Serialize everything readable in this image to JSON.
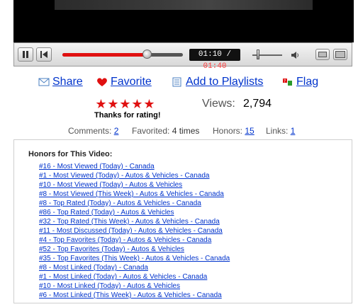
{
  "player": {
    "time_current": "01:10",
    "time_separator": " / ",
    "time_total": "01:40",
    "progress_fraction": 0.7,
    "volume_fraction": 0.2,
    "icons": [
      "pause-icon",
      "previous-icon",
      "volume-icon",
      "normal-size-icon",
      "fullscreen-icon"
    ]
  },
  "actions": {
    "share": "Share",
    "favorite": "Favorite",
    "add_to_playlists": "Add to Playlists",
    "flag": "Flag",
    "icons": [
      "envelope-icon",
      "heart-icon",
      "playlist-icon",
      "flag-icon"
    ]
  },
  "rating": {
    "stars": 5,
    "thanks": "Thanks for rating!"
  },
  "views": {
    "label": "Views:",
    "value": "2,794"
  },
  "stats": {
    "comments_label": "Comments:",
    "comments_value": "2",
    "favorited_label": "Favorited:",
    "favorited_value": "4 times",
    "honors_label": "Honors:",
    "honors_value": "15",
    "links_label": "Links:",
    "links_value": "1"
  },
  "honors": {
    "title": "Honors for This Video:",
    "items": [
      "#16 - Most Viewed (Today) - Canada",
      "#1 - Most Viewed (Today) - Autos & Vehicles - Canada",
      "#10 - Most Viewed (Today) - Autos & Vehicles",
      "#8 - Most Viewed (This Week) - Autos & Vehicles - Canada",
      "#8 - Top Rated (Today) - Autos & Vehicles - Canada",
      "#86 - Top Rated (Today) - Autos & Vehicles",
      "#32 - Top Rated (This Week) - Autos & Vehicles - Canada",
      "#11 - Most Discussed (Today) - Autos & Vehicles - Canada",
      "#4 - Top Favorites (Today) - Autos & Vehicles - Canada",
      "#52 - Top Favorites (Today) - Autos & Vehicles",
      "#35 - Top Favorites (This Week) - Autos & Vehicles - Canada",
      "#8 - Most Linked (Today) - Canada",
      "#1 - Most Linked (Today) - Autos & Vehicles - Canada",
      "#10 - Most Linked (Today) - Autos & Vehicles",
      "#6 - Most Linked (This Week) - Autos & Vehicles - Canada"
    ]
  },
  "colors": {
    "link": "#0033cc",
    "accent_red": "#e01010",
    "player_bg": "#000000"
  }
}
